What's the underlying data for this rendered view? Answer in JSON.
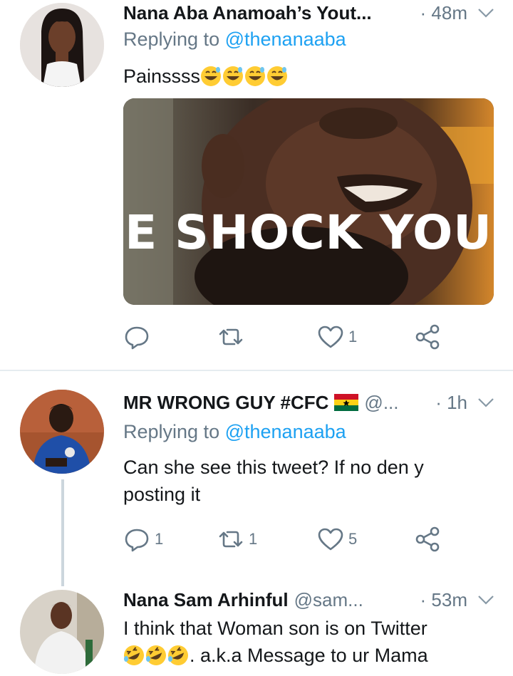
{
  "tweets": [
    {
      "name": "Nana Aba Anamoah’s Yout...",
      "handle": "",
      "time": "· 48m",
      "replying_prefix": "Replying to ",
      "replying_to": "@thenanaaba",
      "text": "Painssss",
      "emoji": [
        "grinning-sweat-face",
        "grinning-sweat-face",
        "grinning-sweat-face",
        "grinning-sweat-face"
      ],
      "media_caption": "E SHOCK YOU",
      "actions": {
        "reply": "",
        "retweet": "",
        "like": "1"
      }
    },
    {
      "name": "MR WRONG GUY #CFC",
      "flag": "ghana-flag",
      "handle": "@...",
      "time": "· 1h",
      "replying_prefix": "Replying to ",
      "replying_to": "@thenanaaba",
      "text_line1": "Can she see this tweet?  If no den y",
      "text_line2": "posting it",
      "actions": {
        "reply": "1",
        "retweet": "1",
        "like": "5"
      }
    },
    {
      "name": "Nana Sam Arhinful",
      "handle": "@sam...",
      "time": "· 53m",
      "text_line1": "I think that Woman son is on Twitter",
      "emoji": [
        "rolling-laughing-face",
        "rolling-laughing-face",
        "rolling-laughing-face"
      ],
      "text_line2_after_emoji": ". a.k.a Message to ur Mama"
    }
  ],
  "colors": {
    "accent": "#1da1f2",
    "muted": "#657786",
    "text": "#14171a",
    "divider": "#e6ecf0",
    "thread_line": "#ccd6dd"
  }
}
